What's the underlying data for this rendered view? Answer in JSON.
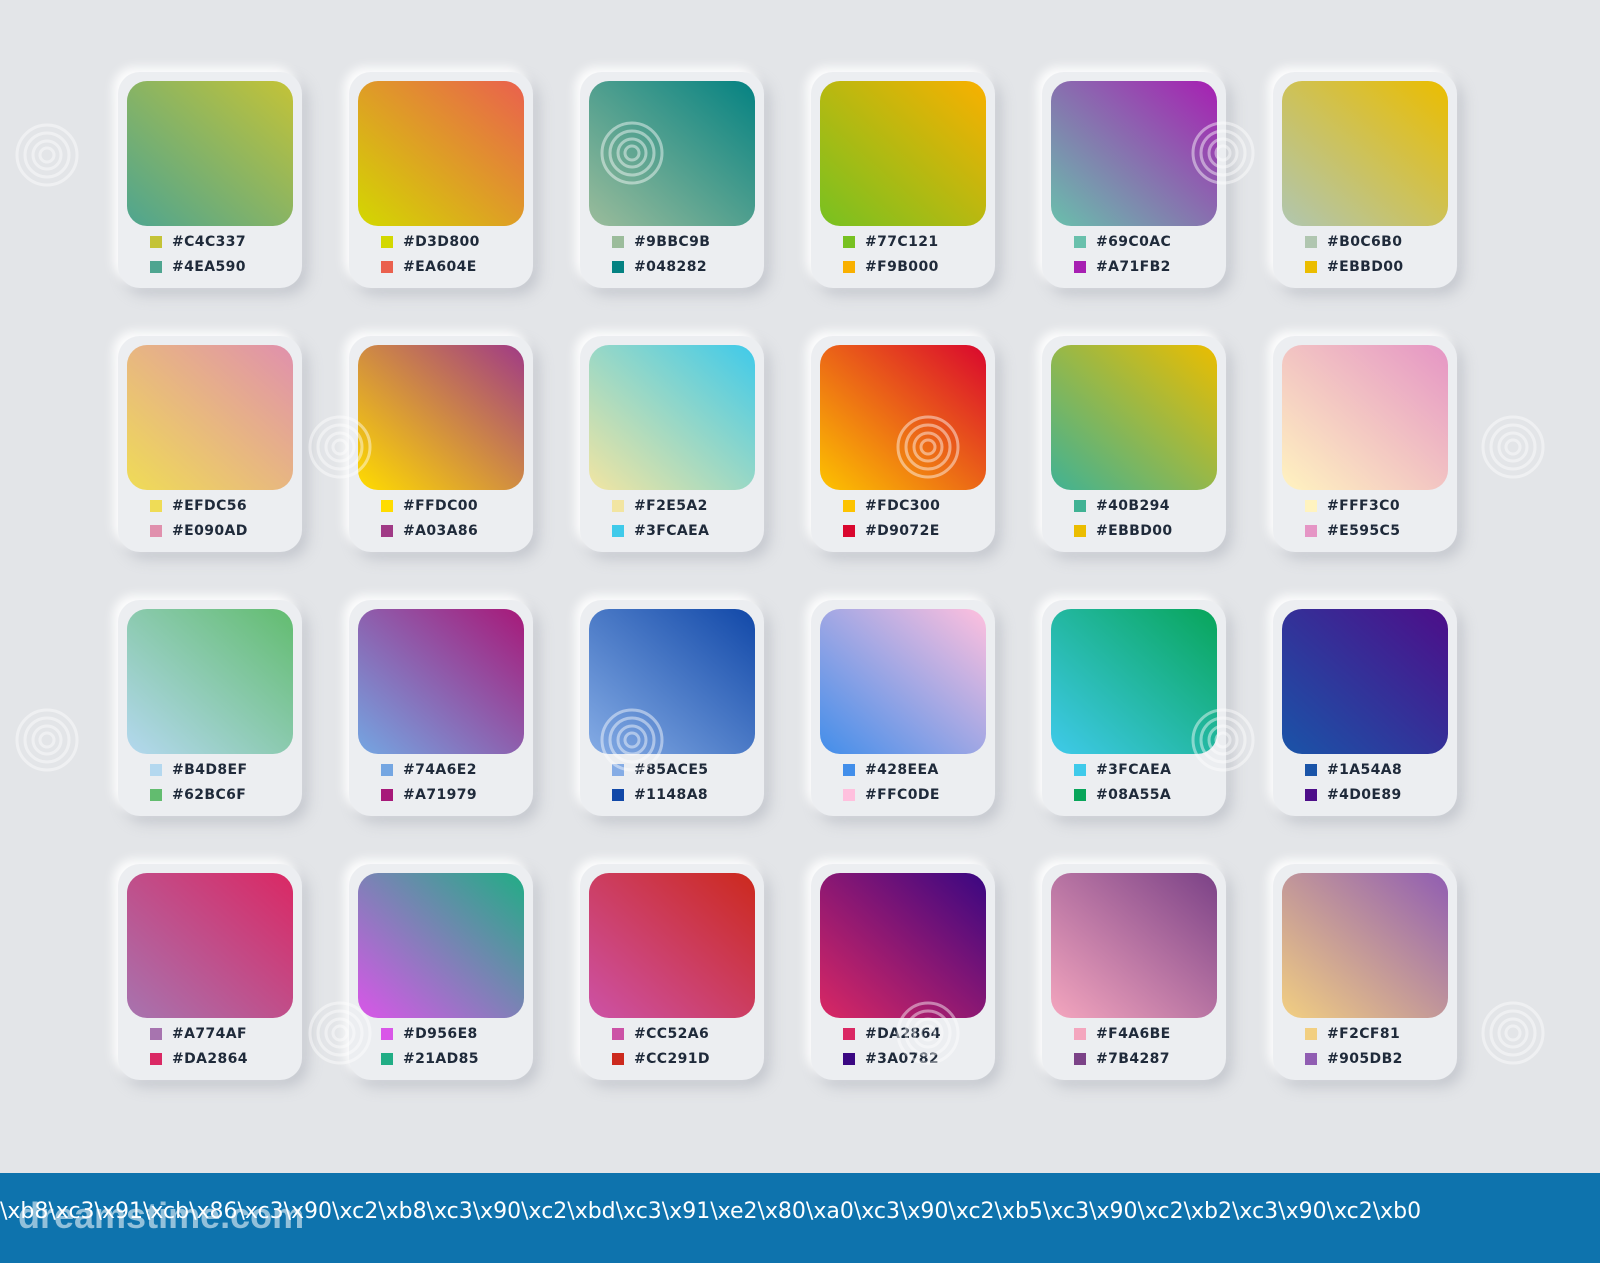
{
  "palette": {
    "cards": [
      {
        "c1": "#C4C337",
        "c2": "#4EA590",
        "codes": [
          "#C4C337",
          "#4EA590"
        ],
        "dir": "to bottom left"
      },
      {
        "c1": "#D3D800",
        "c2": "#EA604E",
        "codes": [
          "#D3D800",
          "#EA604E"
        ],
        "dir": "to top right"
      },
      {
        "c1": "#9BBC9B",
        "c2": "#048282",
        "codes": [
          "#9BBC9B",
          "#048282"
        ],
        "dir": "to top right"
      },
      {
        "c1": "#77C121",
        "c2": "#F9B000",
        "codes": [
          "#77C121",
          "#F9B000"
        ],
        "dir": "to top right"
      },
      {
        "c1": "#69C0AC",
        "c2": "#A71FB2",
        "codes": [
          "#69C0AC",
          "#A71FB2"
        ],
        "dir": "to top right"
      },
      {
        "c1": "#B0C6B0",
        "c2": "#EBBD00",
        "codes": [
          "#B0C6B0",
          "#EBBD00"
        ],
        "dir": "to top right"
      },
      {
        "c1": "#EFDC56",
        "c2": "#E090AD",
        "codes": [
          "#EFDC56",
          "#E090AD"
        ],
        "dir": "to top right"
      },
      {
        "c1": "#FFDC00",
        "c2": "#A03A86",
        "codes": [
          "#FFDC00",
          "#A03A86"
        ],
        "dir": "to top right"
      },
      {
        "c1": "#F2E5A2",
        "c2": "#3FCAEA",
        "codes": [
          "#F2E5A2",
          "#3FCAEA"
        ],
        "dir": "to top right"
      },
      {
        "c1": "#FDC300",
        "c2": "#D9072E",
        "codes": [
          "#FDC300",
          "#D9072E"
        ],
        "dir": "to top right"
      },
      {
        "c1": "#40B294",
        "c2": "#EBBD00",
        "codes": [
          "#40B294",
          "#EBBD00"
        ],
        "dir": "to top right"
      },
      {
        "c1": "#FFF3C0",
        "c2": "#E595C5",
        "codes": [
          "#FFF3C0",
          "#E595C5"
        ],
        "dir": "to top right"
      },
      {
        "c1": "#B4D8EF",
        "c2": "#62BC6F",
        "codes": [
          "#B4D8EF",
          "#62BC6F"
        ],
        "dir": "to top right"
      },
      {
        "c1": "#74A6E2",
        "c2": "#A71979",
        "codes": [
          "#74A6E2",
          "#A71979"
        ],
        "dir": "to top right"
      },
      {
        "c1": "#85ACE5",
        "c2": "#1148A8",
        "codes": [
          "#85ACE5",
          "#1148A8"
        ],
        "dir": "to top right"
      },
      {
        "c1": "#428EEA",
        "c2": "#FFC0DE",
        "codes": [
          "#428EEA",
          "#FFC0DE"
        ],
        "dir": "to top right"
      },
      {
        "c1": "#3FCAEA",
        "c2": "#08A55A",
        "codes": [
          "#3FCAEA",
          "#08A55A"
        ],
        "dir": "to top right"
      },
      {
        "c1": "#1A54A8",
        "c2": "#4D0E89",
        "codes": [
          "#1A54A8",
          "#4D0E89"
        ],
        "dir": "to top right"
      },
      {
        "c1": "#A774AF",
        "c2": "#DA2864",
        "codes": [
          "#A774AF",
          "#DA2864"
        ],
        "dir": "to top right"
      },
      {
        "c1": "#D956E8",
        "c2": "#21AD85",
        "codes": [
          "#D956E8",
          "#21AD85"
        ],
        "dir": "to top right"
      },
      {
        "c1": "#CC52A6",
        "c2": "#CC291D",
        "codes": [
          "#CC52A6",
          "#CC291D"
        ],
        "dir": "to top right"
      },
      {
        "c1": "#DA2864",
        "c2": "#3A0782",
        "codes": [
          "#DA2864",
          "#3A0782"
        ],
        "dir": "to top right"
      },
      {
        "c1": "#F4A6BE",
        "c2": "#7B4287",
        "codes": [
          "#F4A6BE",
          "#7B4287"
        ],
        "dir": "to top right"
      },
      {
        "c1": "#F2CF81",
        "c2": "#905DB2",
        "codes": [
          "#F2CF81",
          "#905DB2"
        ],
        "dir": "to top right"
      }
    ]
  },
  "footer": {
    "logo": "dreamstime.com",
    "text": "\\xb8\\xc3\\x91\\xcb\\x86\\xc3\\x90\\xc2\\xb8\\xc3\\x90\\xc2\\xbd\\xc3\\x91\\xe2\\x80\\xa0\\xc3\\x90\\xc2\\xb5\\xc3\\x90\\xc2\\xb2\\xc3\\x90\\xc2\\xb0",
    "bg": "#0E73AD"
  }
}
